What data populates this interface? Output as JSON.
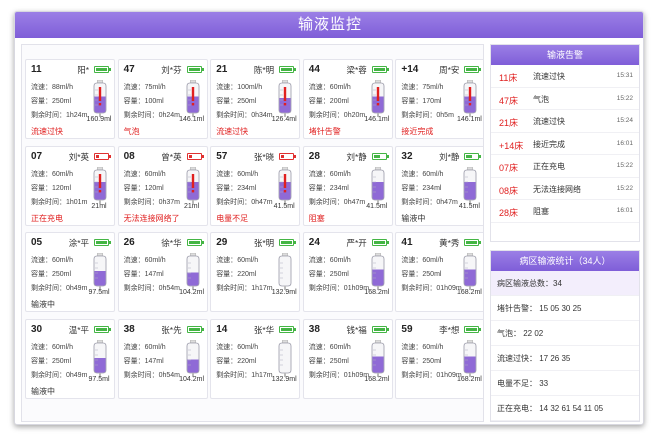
{
  "title": "输液监控",
  "colors": {
    "accent": "#8a6adf",
    "alert": "#e02020",
    "battery_ok": "#44b544",
    "battery_low": "#e03030",
    "fluid": "#8f6ad6",
    "alarm_mark": "#e02020"
  },
  "labels": {
    "speed": "流速：",
    "volume": "容量：",
    "remaining": "剩余时间："
  },
  "cards": [
    {
      "bed": "11",
      "name": "阳*",
      "speed": "88ml/h",
      "volume": "250ml",
      "remain": "1h24m",
      "bag_ml": "160.9ml",
      "fill": 0.55,
      "alarm": true,
      "battery": "full",
      "status": "流速过快",
      "status_red": true
    },
    {
      "bed": "47",
      "name": "刘*芬",
      "speed": "75ml/h",
      "volume": "100ml",
      "remain": "0h24m",
      "bag_ml": "146.1ml",
      "fill": 0.55,
      "alarm": true,
      "battery": "full",
      "status": "气泡",
      "status_red": true
    },
    {
      "bed": "21",
      "name": "陈*明",
      "speed": "100ml/h",
      "volume": "250ml",
      "remain": "0h34m",
      "bag_ml": "126.4ml",
      "fill": 0.5,
      "alarm": true,
      "battery": "full",
      "status": "流速过快",
      "status_red": true
    },
    {
      "bed": "44",
      "name": "梁*蓉",
      "speed": "60ml/h",
      "volume": "200ml",
      "remain": "0h20m",
      "bag_ml": "146.1ml",
      "fill": 0.55,
      "alarm": true,
      "battery": "full",
      "status": "堵针告警",
      "status_red": true
    },
    {
      "bed": "+14",
      "name": "周*安",
      "speed": "75ml/h",
      "volume": "170ml",
      "remain": "0h5m",
      "bag_ml": "146.1ml",
      "fill": 0.55,
      "alarm": true,
      "battery": "full",
      "status": "接近完成",
      "status_red": true
    },
    {
      "bed": "07",
      "name": "刘*英",
      "speed": "60ml/h",
      "volume": "120ml",
      "remain": "1h01m",
      "bag_ml": "21ml",
      "fill": 0.6,
      "alarm": true,
      "battery": "low",
      "status": "正在充电",
      "status_red": true
    },
    {
      "bed": "08",
      "name": "曾*英",
      "speed": "60ml/h",
      "volume": "120ml",
      "remain": "0h37m",
      "bag_ml": "21ml",
      "fill": 0.6,
      "alarm": true,
      "battery": "low",
      "status": "无法连接网络了",
      "status_red": true
    },
    {
      "bed": "57",
      "name": "张*晓",
      "speed": "60ml/h",
      "volume": "234ml",
      "remain": "0h47m",
      "bag_ml": "41.5ml",
      "fill": 0.6,
      "alarm": true,
      "battery": "charge",
      "status": "电量不足",
      "status_red": true
    },
    {
      "bed": "28",
      "name": "刘*静",
      "speed": "60ml/h",
      "volume": "234ml",
      "remain": "0h47m",
      "bag_ml": "41.5ml",
      "fill": 0.6,
      "alarm": false,
      "battery": "half",
      "status": "阻塞",
      "status_red": true
    },
    {
      "bed": "32",
      "name": "刘*静",
      "speed": "60ml/h",
      "volume": "234ml",
      "remain": "0h47m",
      "bag_ml": "41.5ml",
      "fill": 0.6,
      "alarm": false,
      "battery": "half",
      "status": "输液中",
      "status_red": false
    },
    {
      "bed": "05",
      "name": "涂*平",
      "speed": "60ml/h",
      "volume": "250ml",
      "remain": "0h49m",
      "bag_ml": "97.5ml",
      "fill": 0.5,
      "alarm": false,
      "battery": "full",
      "status": "输液中",
      "status_red": false
    },
    {
      "bed": "26",
      "name": "徐*华",
      "speed": "60ml/h",
      "volume": "147ml",
      "remain": "0h54m",
      "bag_ml": "104.2ml",
      "fill": 0.45,
      "alarm": false,
      "battery": "full",
      "status": "",
      "status_red": false
    },
    {
      "bed": "29",
      "name": "张*明",
      "speed": "60ml/h",
      "volume": "220ml",
      "remain": "1h17m",
      "bag_ml": "132.9ml",
      "fill": 0.0,
      "alarm": false,
      "battery": "full",
      "status": "",
      "status_red": false
    },
    {
      "bed": "24",
      "name": "严*开",
      "speed": "60ml/h",
      "volume": "250ml",
      "remain": "01h09m",
      "bag_ml": "168.2ml",
      "fill": 0.55,
      "alarm": false,
      "battery": "full",
      "status": "",
      "status_red": false
    },
    {
      "bed": "41",
      "name": "黄*秀",
      "speed": "60ml/h",
      "volume": "250ml",
      "remain": "01h09m",
      "bag_ml": "168.2ml",
      "fill": 0.55,
      "alarm": false,
      "battery": "full",
      "status": "",
      "status_red": false
    },
    {
      "bed": "30",
      "name": "温*平",
      "speed": "60ml/h",
      "volume": "250ml",
      "remain": "0h49m",
      "bag_ml": "97.5ml",
      "fill": 0.5,
      "alarm": false,
      "battery": "full",
      "status": "输液中",
      "status_red": false
    },
    {
      "bed": "38",
      "name": "张*先",
      "speed": "60ml/h",
      "volume": "147ml",
      "remain": "0h54m",
      "bag_ml": "104.2ml",
      "fill": 0.45,
      "alarm": false,
      "battery": "full",
      "status": "",
      "status_red": false
    },
    {
      "bed": "14",
      "name": "张*华",
      "speed": "60ml/h",
      "volume": "220ml",
      "remain": "1h17m",
      "bag_ml": "132.9ml",
      "fill": 0.0,
      "alarm": false,
      "battery": "full",
      "status": "",
      "status_red": false
    },
    {
      "bed": "38",
      "name": "钱*福",
      "speed": "60ml/h",
      "volume": "250ml",
      "remain": "01h09m",
      "bag_ml": "168.2ml",
      "fill": 0.55,
      "alarm": false,
      "battery": "full",
      "status": "",
      "status_red": false
    },
    {
      "bed": "59",
      "name": "李*想",
      "speed": "60ml/h",
      "volume": "250ml",
      "remain": "01h09m",
      "bag_ml": "168.2ml",
      "fill": 0.55,
      "alarm": false,
      "battery": "full",
      "status": "",
      "status_red": false
    }
  ],
  "alarm_panel": {
    "title": "输液告警",
    "rows": [
      {
        "bed": "11床",
        "type": "流速过快",
        "time": "15:31"
      },
      {
        "bed": "47床",
        "type": "气泡",
        "time": "15:22"
      },
      {
        "bed": "21床",
        "type": "流速过快",
        "time": "15:24"
      },
      {
        "bed": "+14床",
        "type": "接近完成",
        "time": "16:01"
      },
      {
        "bed": "07床",
        "type": "正在充电",
        "time": "15:22"
      },
      {
        "bed": "08床",
        "type": "无法连接网络",
        "time": "15:22"
      },
      {
        "bed": "28床",
        "type": "阻塞",
        "time": "16:01"
      }
    ]
  },
  "stats_panel": {
    "title": "病区输液统计（34人）",
    "rows": [
      "病区输液总数：34",
      "堵针告警：  15    05    30    25",
      "气泡：  22    02",
      "流速过快：  17    26    35",
      "电量不足：  33",
      "正在充电：  14    32    61    54    11    05"
    ]
  }
}
